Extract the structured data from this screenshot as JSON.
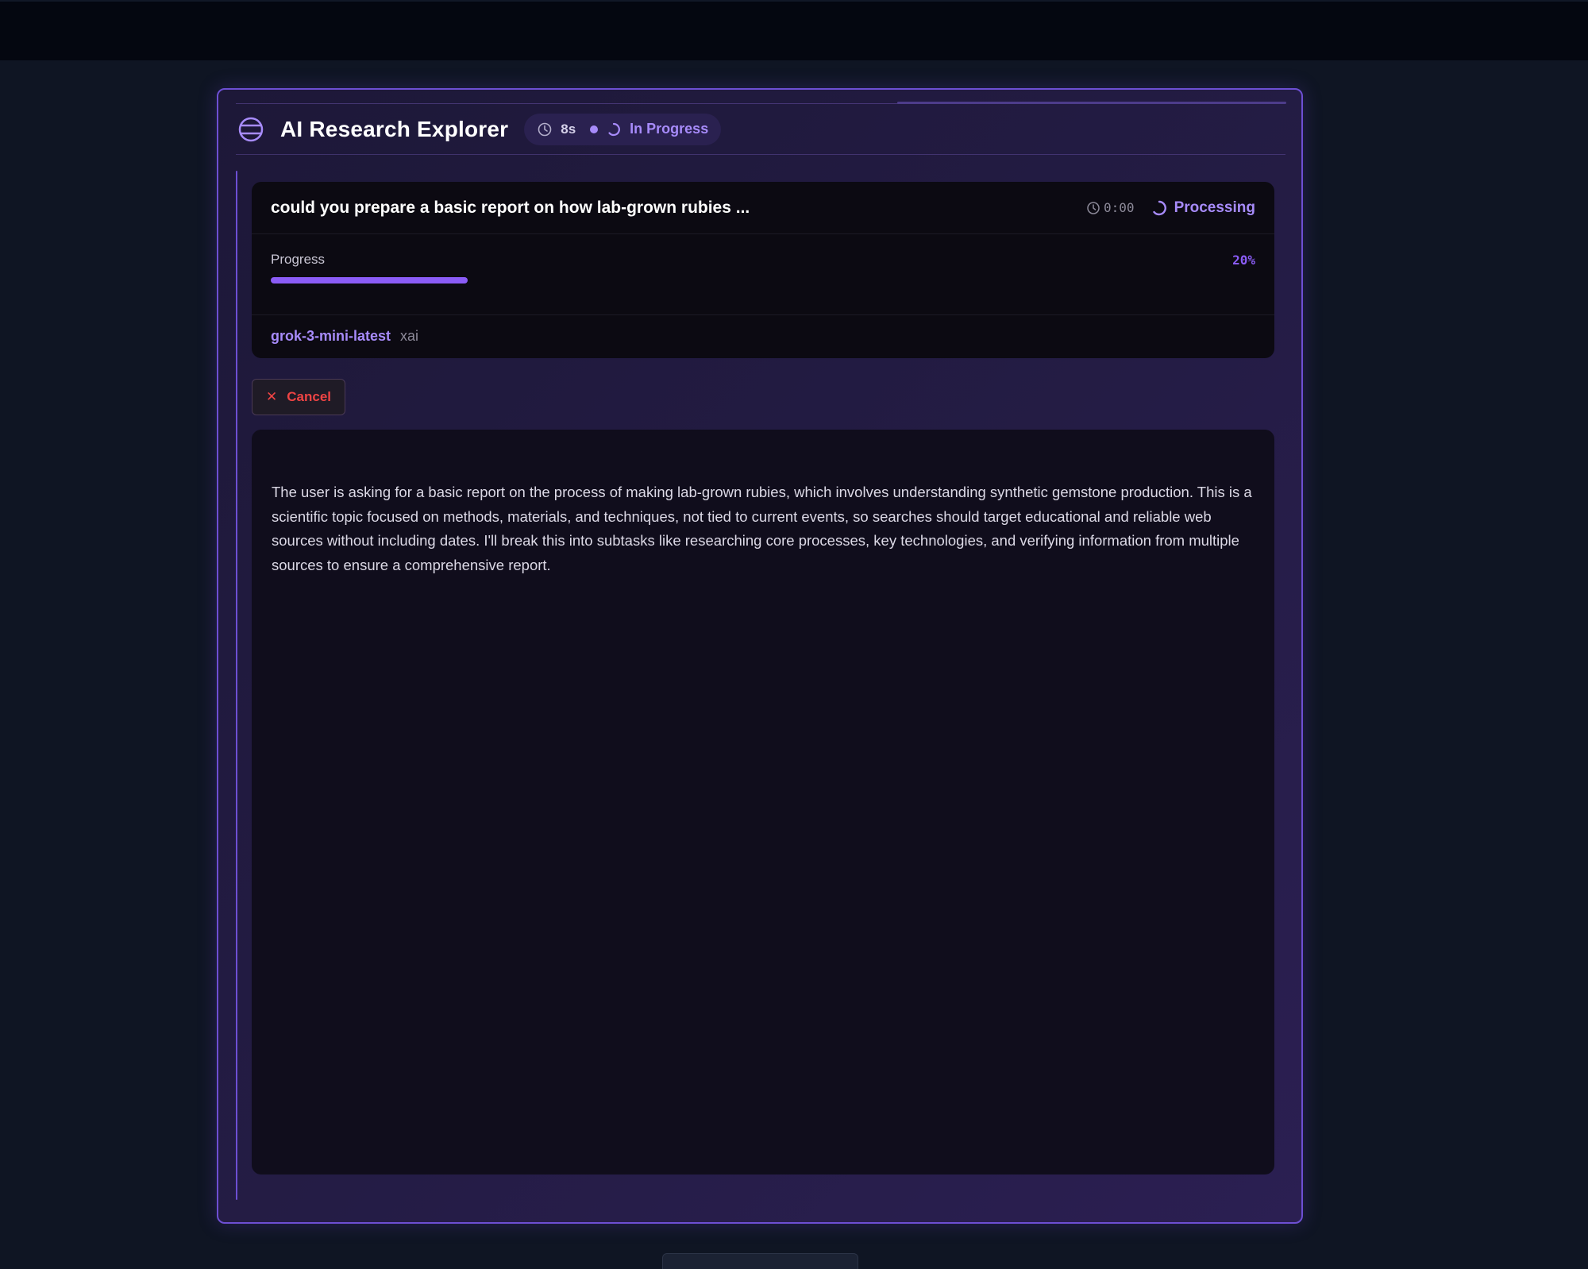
{
  "app": {
    "title": "AI Research Explorer",
    "elapsed": "8s",
    "status": "In Progress"
  },
  "task": {
    "title": "could you prepare a basic report on how lab-grown rubies ...",
    "timer": "0:00",
    "status": "Processing",
    "progress_label": "Progress",
    "progress_text": "20%",
    "progress_fraction": 0.2,
    "model_name": "grok-3-mini-latest",
    "model_provider": "xai"
  },
  "actions": {
    "cancel_label": "Cancel",
    "cancel_glyph": "✕"
  },
  "reasoning": {
    "text": "The user is asking for a basic report on the process of making lab-grown rubies, which involves understanding synthetic gemstone production. This is a scientific topic focused on methods, materials, and techniques, not tied to current events, so searches should target educational and reliable web sources without including dates. I'll break this into subtasks like researching core processes, key technologies, and verifying information from multiple sources to ensure a comprehensive report."
  },
  "colors": {
    "accent": "#8b5cf6",
    "accent_light": "#a78bfa",
    "danger": "#ef4444",
    "panel_border": "#6d4fd3",
    "background": "#0f1523"
  },
  "icons": {
    "app": "globe-icon",
    "elapsed": "clock-icon",
    "status": "spinner-icon",
    "cancel": "close-icon"
  }
}
